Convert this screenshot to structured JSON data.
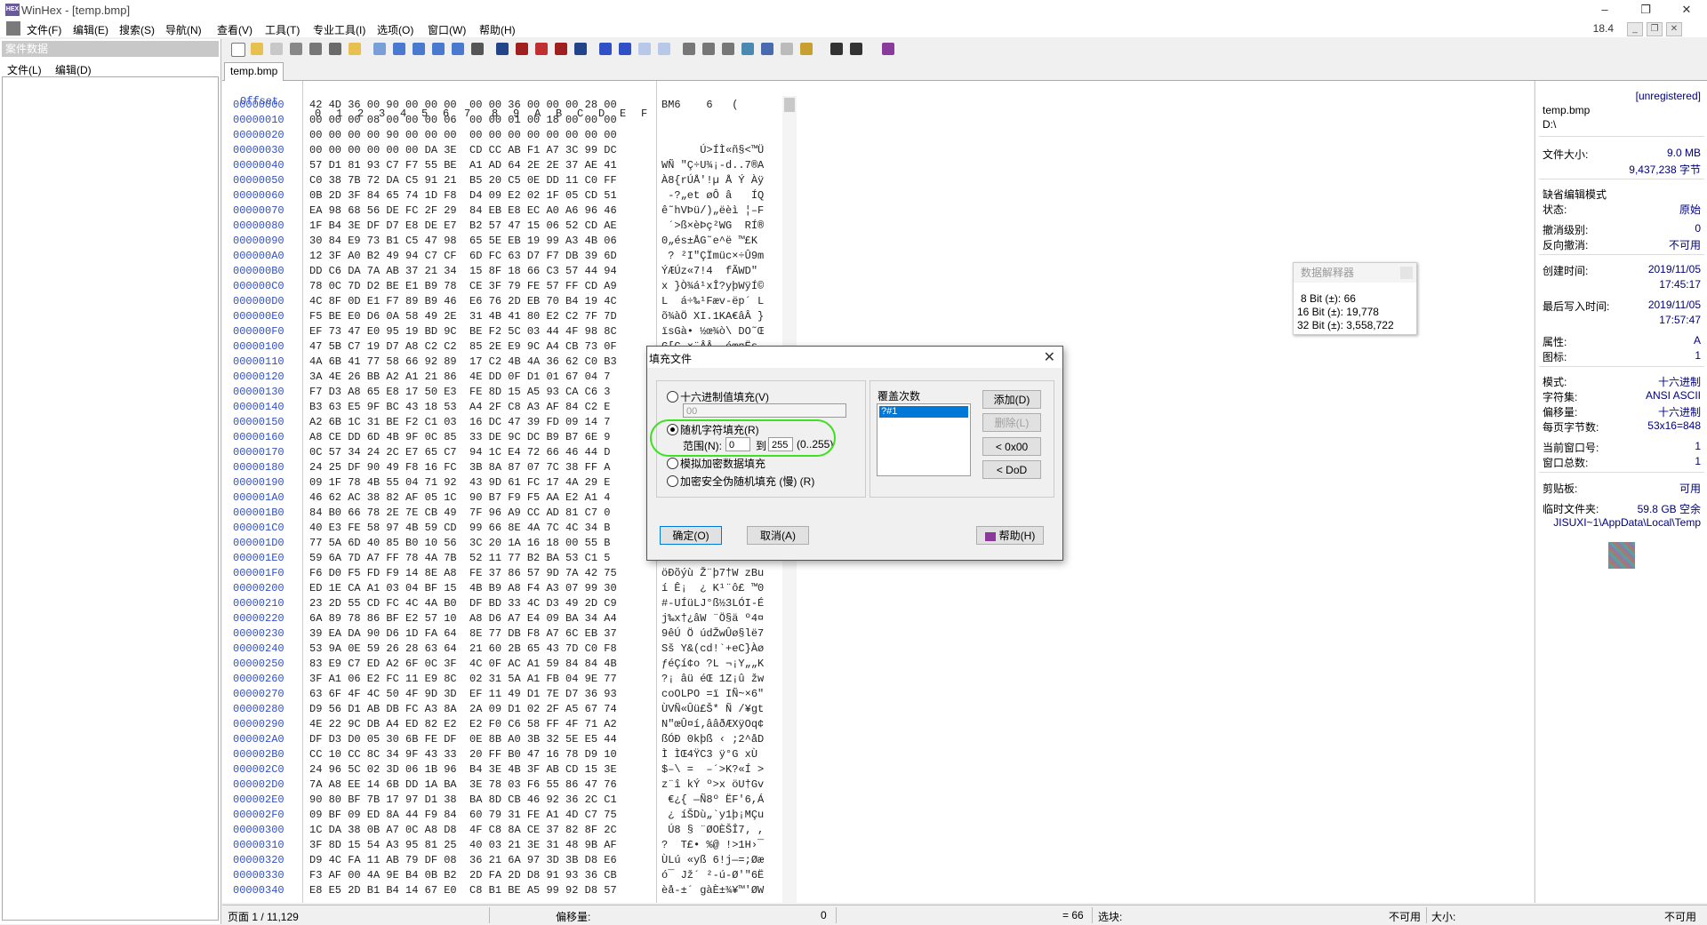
{
  "window": {
    "title": "WinHex - [temp.bmp]",
    "minimize": "–",
    "restore": "❐",
    "close": "✕"
  },
  "menu": {
    "items": [
      "文件(F)",
      "编辑(E)",
      "搜索(S)",
      "导航(N)",
      "查看(V)",
      "工具(T)",
      "专业工具(I)",
      "选项(O)",
      "窗口(W)",
      "帮助(H)"
    ],
    "version": "18.4"
  },
  "left_panel": {
    "header": "案件数据",
    "menu": [
      "文件(L)",
      "编辑(D)"
    ]
  },
  "tab": {
    "label": "temp.bmp"
  },
  "hex_view": {
    "offset_header": "Offset",
    "column_headers": [
      "0",
      "1",
      "2",
      "3",
      "4",
      "5",
      "6",
      "7",
      "8",
      "9",
      "A",
      "B",
      "C",
      "D",
      "E",
      "F"
    ],
    "rows": [
      {
        "offset": "00000000",
        "hex": "42 4D 36 00 90 00 00 00  00 00 36 00 00 00 28 00",
        "ascii": "BM6    6   ("
      },
      {
        "offset": "00000010",
        "hex": "00 00 00 08 00 00 00 06  00 00 01 00 18 00 00 00",
        "ascii": ""
      },
      {
        "offset": "00000020",
        "hex": "00 00 00 00 90 00 00 00  00 00 00 00 00 00 00 00",
        "ascii": ""
      },
      {
        "offset": "00000030",
        "hex": "00 00 00 00 00 00 DA 3E  CD CC AB F1 A7 3C 99 DC",
        "ascii": "      Ú>ÍÌ«ñ§<™Ü"
      },
      {
        "offset": "00000040",
        "hex": "57 D1 81 93 C7 F7 55 BE  A1 AD 64 2E 2E 37 AE 41",
        "ascii": "WÑ \"Ç÷U¾¡-d..7®A"
      },
      {
        "offset": "00000050",
        "hex": "C0 38 7B 72 DA C5 91 21  B5 20 C5 0E DD 11 C0 FF",
        "ascii": "À8{rÚÅ'!µ Å Ý Àÿ"
      },
      {
        "offset": "00000060",
        "hex": "0B 2D 3F 84 65 74 1D F8  D4 09 E2 02 1F 05 CD 51",
        "ascii": " -?„et øÔ â   ÍQ"
      },
      {
        "offset": "00000070",
        "hex": "EA 98 68 56 DE FC 2F 29  84 EB E8 EC A0 A6 96 46",
        "ascii": "ê˜hVÞü/)„ëèì ¦–F"
      },
      {
        "offset": "00000080",
        "hex": "1F B4 3E DF D7 E8 DE E7  B2 57 47 15 06 52 CD AE",
        "ascii": " ´>ß×èÞç²WG  RÍ®"
      },
      {
        "offset": "00000090",
        "hex": "30 84 E9 73 B1 C5 47 98  65 5E EB 19 99 A3 4B 06",
        "ascii": "0„és±ÅG˜e^ë ™£K"
      },
      {
        "offset": "000000A0",
        "hex": "12 3F A0 B2 49 94 C7 CF  6D FC 63 D7 F7 DB 39 6D",
        "ascii": " ? ²I\"ÇÏmüc×÷Û9m"
      },
      {
        "offset": "000000B0",
        "hex": "DD C6 DA 7A AB 37 21 34  15 8F 18 66 C3 57 44 94",
        "ascii": "ÝÆÚz«7!4  fÃWD\""
      },
      {
        "offset": "000000C0",
        "hex": "78 0C 7D D2 BE E1 B9 78  CE 3F 79 FE 57 FF CD A9",
        "ascii": "x }Ò¾á¹xÎ?yþWÿÍ©"
      },
      {
        "offset": "000000D0",
        "hex": "4C 8F 0D E1 F7 89 B9 46  E6 76 2D EB 70 B4 19 4C",
        "ascii": "L  á÷‰¹Fæv-ëp´ L"
      },
      {
        "offset": "000000E0",
        "hex": "F5 BE E0 D6 0A 58 49 2E  31 4B 41 80 E2 C2 7F 7D",
        "ascii": "õ¾àÖ XI.1KA€âÂ }"
      },
      {
        "offset": "000000F0",
        "hex": "EF 73 47 E0 95 19 BD 9C  BE F2 5C 03 44 4F 98 8C",
        "ascii": "ïsGà• ½œ¾ò\\ DO˜Œ"
      },
      {
        "offset": "00000100",
        "hex": "47 5B C7 19 D7 A8 C2 C2  85 2E E9 9C A4 CB 73 0F",
        "ascii": "G[Ç ×¨ÂÂ….éœ¤Ës"
      },
      {
        "offset": "00000110",
        "hex": "4A 6B 41 77 58 66 92 89  17 C2 4B 4A 36 62 C0 B3",
        "ascii": ""
      },
      {
        "offset": "00000120",
        "hex": "3A 4E 26 BB A2 A1 21 86  4E DD 0F D1 01 67 04 7",
        "ascii": ""
      },
      {
        "offset": "00000130",
        "hex": "F7 D3 A8 65 E8 17 50 E3  FE 8D 15 A5 93 CA C6 3",
        "ascii": ""
      },
      {
        "offset": "00000140",
        "hex": "B3 63 E5 9F BC 43 18 53  A4 2F C8 A3 AF 84 C2 E",
        "ascii": ""
      },
      {
        "offset": "00000150",
        "hex": "A2 6B 1C 31 BE F2 C1 03  16 DC 47 39 FD 09 14 7",
        "ascii": ""
      },
      {
        "offset": "00000160",
        "hex": "A8 CE DD 6D 4B 9F 0C 85  33 DE 9C DC B9 B7 6E 9",
        "ascii": ""
      },
      {
        "offset": "00000170",
        "hex": "0C 57 34 24 2C E7 65 C7  94 1C E4 72 66 46 44 D",
        "ascii": ""
      },
      {
        "offset": "00000180",
        "hex": "24 25 DF 90 49 F8 16 FC  3B 8A 87 07 7C 38 FF A",
        "ascii": ""
      },
      {
        "offset": "00000190",
        "hex": "09 1F 78 4B 55 04 71 92  43 9D 61 FC 17 4A 29 E",
        "ascii": ""
      },
      {
        "offset": "000001A0",
        "hex": "46 62 AC 38 82 AF 05 1C  90 B7 F9 F5 AA E2 A1 4",
        "ascii": ""
      },
      {
        "offset": "000001B0",
        "hex": "84 B0 66 78 2E 7E CB 49  7F 96 A9 CC AD 81 C7 0",
        "ascii": ""
      },
      {
        "offset": "000001C0",
        "hex": "40 E3 FE 58 97 4B 59 CD  99 66 8E 4A 7C 4C 34 B",
        "ascii": ""
      },
      {
        "offset": "000001D0",
        "hex": "77 5A 6D 40 85 B0 10 56  3C 20 1A 16 18 00 55 B",
        "ascii": ""
      },
      {
        "offset": "000001E0",
        "hex": "59 6A 7D A7 FF 78 4A 7B  52 11 77 B2 BA 53 C1 5",
        "ascii": ""
      },
      {
        "offset": "000001F0",
        "hex": "F6 D0 F5 FD F9 14 8E A8  FE 37 86 57 9D 7A 42 75",
        "ascii": "öÐõýù Ž¨þ7†W zBu"
      },
      {
        "offset": "00000200",
        "hex": "ED 1E CA A1 03 04 BF 15  4B B9 A8 F4 A3 07 99 30",
        "ascii": "í Ê¡  ¿ K¹¨ô£ ™0"
      },
      {
        "offset": "00000210",
        "hex": "23 2D 55 CD FC 4C 4A B0  DF BD 33 4C D3 49 2D C9",
        "ascii": "#-UÍüLJ°ß½3LÓI-É"
      },
      {
        "offset": "00000220",
        "hex": "6A 89 78 86 BF E2 57 10  A8 D6 A7 E4 09 BA 34 A4",
        "ascii": "j‰x†¿âW ¨Ö§ä º4¤"
      },
      {
        "offset": "00000230",
        "hex": "39 EA DA 90 D6 1D FA 64  8E 77 DB F8 A7 6C EB 37",
        "ascii": "9êÚ Ö údŽwÛø§lë7"
      },
      {
        "offset": "00000240",
        "hex": "53 9A 0E 59 26 28 63 64  21 60 2B 65 43 7D C0 F8",
        "ascii": "Sš Y&(cd!`+eC}Àø"
      },
      {
        "offset": "00000250",
        "hex": "83 E9 C7 ED A2 6F 0C 3F  4C 0F AC A1 59 84 84 4B",
        "ascii": "ƒéÇí¢o ?L ¬¡Y„„K"
      },
      {
        "offset": "00000260",
        "hex": "3F A1 06 E2 FC 11 E9 8C  02 31 5A A1 FB 04 9E 77",
        "ascii": "?¡ âü éŒ 1Z¡û žw"
      },
      {
        "offset": "00000270",
        "hex": "63 6F 4F 4C 50 4F 9D 3D  EF 11 49 D1 7E D7 36 93",
        "ascii": "coOLPO =ï IÑ~×6\""
      },
      {
        "offset": "00000280",
        "hex": "D9 56 D1 AB DB FC A3 8A  2A 09 D1 02 2F A5 67 74",
        "ascii": "ÙVÑ«Ûü£Š* Ñ /¥gt"
      },
      {
        "offset": "00000290",
        "hex": "4E 22 9C DB A4 ED 82 E2  E2 F0 C6 58 FF 4F 71 A2",
        "ascii": "N\"œÛ¤í‚ââðÆXÿOq¢"
      },
      {
        "offset": "000002A0",
        "hex": "DF D3 D0 05 30 6B FE DF  0E 8B A0 3B 32 5E E5 44",
        "ascii": "ßÓÐ 0kþß ‹ ;2^åD"
      },
      {
        "offset": "000002B0",
        "hex": "CC 10 CC 8C 34 9F 43 33  20 FF B0 47 16 78 D9 10",
        "ascii": "Ì ÌŒ4ŸC3 ÿ°G xÙ"
      },
      {
        "offset": "000002C0",
        "hex": "24 96 5C 02 3D 06 1B 96  B4 3E 4B 3F AB CD 15 3E",
        "ascii": "$–\\ =  –´>K?«Í >"
      },
      {
        "offset": "000002D0",
        "hex": "7A A8 EE 14 6B DD 1A BA  3E 78 03 F6 55 86 47 76",
        "ascii": "z¨î kÝ º>x öU†Gv"
      },
      {
        "offset": "000002E0",
        "hex": "90 80 BF 7B 17 97 D1 38  BA 8D CB 46 92 36 2C C1",
        "ascii": " €¿{ —Ñ8º ËF'6,Á"
      },
      {
        "offset": "000002F0",
        "hex": "09 BF 09 ED 8A 44 F9 84  60 79 31 FE A1 4D C7 75",
        "ascii": " ¿ íŠDù„`y1þ¡MÇu"
      },
      {
        "offset": "00000300",
        "hex": "1C DA 38 0B A7 0C A8 D8  4F C8 8A CE 37 82 8F 2C",
        "ascii": " Ú8 § ¨ØOÈŠÎ7‚ ,"
      },
      {
        "offset": "00000310",
        "hex": "3F 8D 15 54 A3 95 81 25  40 03 21 3E 31 48 9B AF",
        "ascii": "?  T£• %@ !>1H›¯"
      },
      {
        "offset": "00000320",
        "hex": "D9 4C FA 11 AB 79 DF 08  36 21 6A 97 3D 3B D8 E6",
        "ascii": "ÙLú «yß 6!j—=;Øæ"
      },
      {
        "offset": "00000330",
        "hex": "F3 AF 00 4A 9E B4 0B B2  2D FA 2D D8 91 93 36 CB",
        "ascii": "ó¯ Jž´ ²-ú-Ø'\"6Ë"
      },
      {
        "offset": "00000340",
        "hex": "E8 E5 2D B1 B4 14 67 E0  C8 B1 BE A5 99 92 D8 57",
        "ascii": "èå-±´ gàÈ±¾¥™'ØW"
      }
    ]
  },
  "info": {
    "unregistered": "[unregistered]",
    "file_name": "temp.bmp",
    "path": "D:\\",
    "size_label": "文件大小:",
    "size_mb": "9.0 MB",
    "size_bytes": "9,437,238 字节",
    "edit_mode": "缺省编辑模式",
    "state_label": "状态:",
    "state_value": "原始",
    "undo_label": "撤消级别:",
    "undo_value": "0",
    "reverse_label": "反向撤消:",
    "reverse_value": "不可用",
    "created_label": "创建时间:",
    "created_date": "2019/11/05",
    "created_time": "17:45:17",
    "written_label": "最后写入时间:",
    "written_date": "2019/11/05",
    "written_time": "17:57:47",
    "attr_label": "属性:",
    "attr_value": "A",
    "icons_label": "图标:",
    "icons_value": "1",
    "mode_label": "模式:",
    "mode_value": "十六进制",
    "charset_label": "字符集:",
    "charset_value": "ANSI ASCII",
    "offset_label": "偏移量:",
    "offset_value": "十六进制",
    "bpp_label": "每页字节数:",
    "bpp_value": "53x16=848",
    "curwin_label": "当前窗口号:",
    "curwin_value": "1",
    "totalwin_label": "窗口总数:",
    "totalwin_value": "1",
    "clip_label": "剪贴板:",
    "clip_value": "可用",
    "temp_label": "临时文件夹:",
    "temp_value": "59.8 GB 空余",
    "temp_path": "JISUXI~1\\AppData\\Local\\Temp"
  },
  "interpreter": {
    "title": "数据解释器",
    "rows": [
      "8 Bit (±): 66",
      "16 Bit (±): 19,778",
      "32 Bit (±): 3,558,722"
    ]
  },
  "dialog": {
    "title": "填充文件",
    "close": "✕",
    "opt_hex": "十六进制值填充(V)",
    "hex_value": "00",
    "opt_random": "随机字符填充(R)",
    "range_label": "范围(N):",
    "range_from": "0",
    "range_to_label": "到",
    "range_to": "255",
    "range_hint": "(0..255)",
    "opt_sim": "模拟加密数据填充",
    "opt_secure": "加密安全伪随机填充 (慢) (R)",
    "passes_label": "覆盖次数",
    "passes_item": "?#1",
    "add": "添加(D)",
    "delete": "删除(L)",
    "b0x00": "< 0x00",
    "bdod": "< DoD",
    "ok": "确定(O)",
    "cancel": "取消(A)",
    "help": "帮助(H)"
  },
  "status": {
    "page": "页面 1 / 11,129",
    "offset_label": "偏移量:",
    "offset_value": "0",
    "eq": "= 66",
    "sel_label": "选块:",
    "na": "不可用",
    "size_label": "大小:",
    "na2": "不可用"
  },
  "colors": {
    "offset_blue": "#3050c8",
    "highlight_green": "#3ee01f",
    "info_value": "#00007a"
  }
}
